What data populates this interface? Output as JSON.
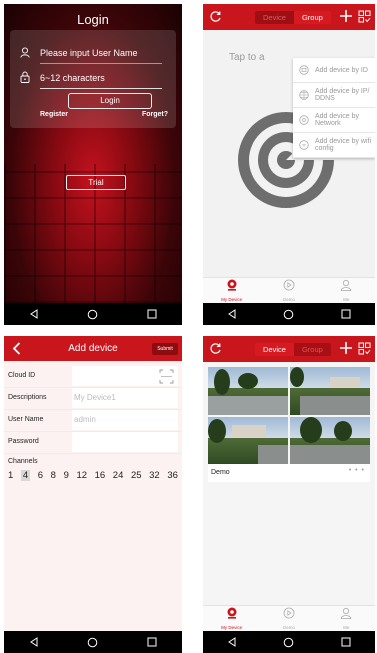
{
  "login": {
    "title": "Login",
    "username_placeholder": "Please input User Name",
    "password_placeholder": "6~12 characters",
    "login_button": "Login",
    "register_link": "Register",
    "forget_link": "Forget?",
    "trial_button": "Trial"
  },
  "devices_menu": {
    "tabs": [
      "Device",
      "Group"
    ],
    "hint_text": "Tap to a",
    "menu_items": [
      {
        "label": "Add device by ID",
        "icon": "id-icon"
      },
      {
        "label": "Add device by IP/ DDNS",
        "icon": "globe-icon"
      },
      {
        "label": "Add device by Network",
        "icon": "network-icon"
      },
      {
        "label": "Add device by wifi config",
        "icon": "wifi-icon"
      }
    ]
  },
  "tabbar": {
    "items": [
      "My Device",
      "Demo",
      "Me"
    ],
    "active": "My Device"
  },
  "add_device": {
    "title": "Add device",
    "submit": "Submit",
    "fields": [
      {
        "label": "Cloud ID",
        "value": ""
      },
      {
        "label": "Descriptions",
        "value": "My Device1"
      },
      {
        "label": "User Name",
        "value": "admin"
      },
      {
        "label": "Password",
        "value": ""
      }
    ],
    "channels_label": "Channels",
    "channels": [
      "1",
      "4",
      "6",
      "8",
      "9",
      "12",
      "16",
      "24",
      "25",
      "32",
      "36"
    ],
    "selected_channel": "4"
  },
  "demo_list": {
    "tabs": [
      "Device",
      "Group"
    ],
    "device_name": "Demo",
    "more": "• • •"
  },
  "colors": {
    "accent": "#c9151c",
    "dark_accent": "#8c0c10"
  }
}
